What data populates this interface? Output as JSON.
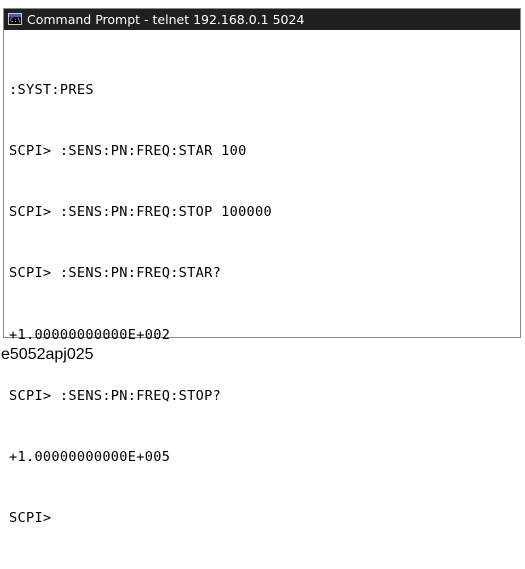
{
  "window": {
    "title": "Command Prompt - telnet 192.168.0.1 5024",
    "icon": "cmd-console-icon",
    "icon_glyph": "C:\\",
    "titlebar_color": "#202020",
    "background_color": "#ffffff",
    "text_color": "#000000"
  },
  "console": {
    "lines": [
      ":SYST:PRES",
      "SCPI> :SENS:PN:FREQ:STAR 100",
      "SCPI> :SENS:PN:FREQ:STOP 100000",
      "SCPI> :SENS:PN:FREQ:STAR?",
      "+1.00000000000E+002",
      "SCPI> :SENS:PN:FREQ:STOP?",
      "+1.00000000000E+005",
      "SCPI>"
    ]
  },
  "caption": "e5052apj025"
}
